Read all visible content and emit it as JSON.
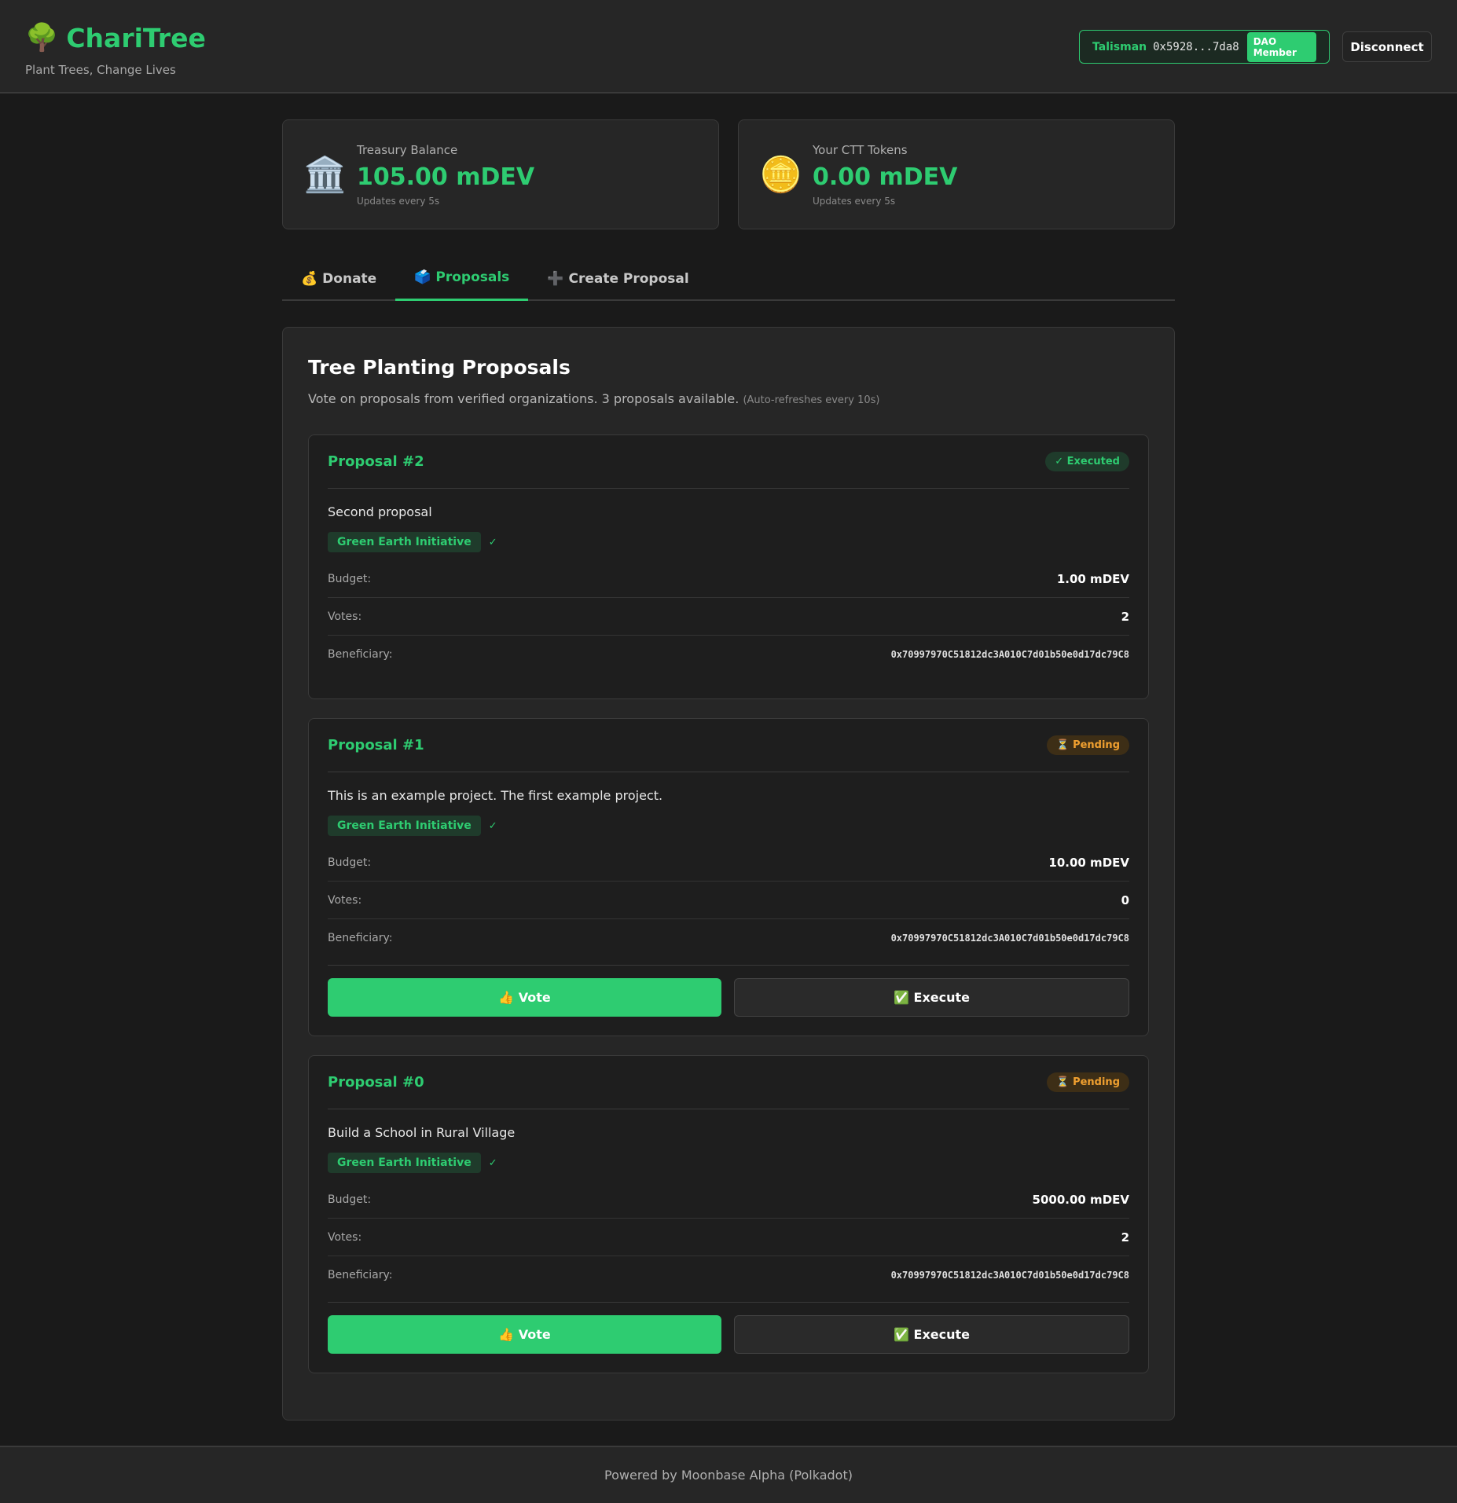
{
  "header": {
    "logo_icon": "🌳",
    "title": "ChariTree",
    "subtitle": "Plant Trees, Change Lives",
    "wallet_name": "Talisman",
    "wallet_address": "0x5928...7da8",
    "member_badge": "DAO Member",
    "disconnect_label": "Disconnect"
  },
  "stats": [
    {
      "icon": "🏛️",
      "label": "Treasury Balance",
      "value": "105.00 mDEV",
      "note": "Updates every 5s"
    },
    {
      "icon": "🪙",
      "label": "Your CTT Tokens",
      "value": "0.00 mDEV",
      "note": "Updates every 5s"
    }
  ],
  "tabs": [
    {
      "icon": "💰",
      "label": "Donate",
      "active": false
    },
    {
      "icon": "🗳️",
      "label": "Proposals",
      "active": true
    },
    {
      "icon": "➕",
      "label": "Create Proposal",
      "active": false
    }
  ],
  "panel": {
    "title": "Tree Planting Proposals",
    "description": "Vote on proposals from verified organizations. 3 proposals available.",
    "refresh_note": "(Auto-refreshes every 10s)"
  },
  "labels": {
    "budget": "Budget:",
    "votes": "Votes:",
    "beneficiary": "Beneficiary:",
    "verified": "✓"
  },
  "proposals": [
    {
      "title": "Proposal #2",
      "status": "✓ Executed",
      "description": "Second proposal",
      "organization": "Green Earth Initiative",
      "budget": "1.00 mDEV",
      "votes": "2",
      "beneficiary": "0x70997970C51812dc3A010C7d01b50e0d17dc79C8"
    },
    {
      "title": "Proposal #1",
      "status": "⏳ Pending",
      "description": "This is an example project. The first example project.",
      "organization": "Green Earth Initiative",
      "budget": "10.00 mDEV",
      "votes": "0",
      "beneficiary": "0x70997970C51812dc3A010C7d01b50e0d17dc79C8",
      "vote_label": "👍 Vote",
      "execute_label": "✅ Execute"
    },
    {
      "title": "Proposal #0",
      "status": "⏳ Pending",
      "description": "Build a School in Rural Village",
      "organization": "Green Earth Initiative",
      "budget": "5000.00 mDEV",
      "votes": "2",
      "beneficiary": "0x70997970C51812dc3A010C7d01b50e0d17dc79C8",
      "vote_label": "👍 Vote",
      "execute_label": "✅ Execute"
    }
  ],
  "footer": {
    "text": "Powered by Moonbase Alpha (Polkadot)"
  },
  "colors": {
    "accent": "#2ecc71",
    "pending": "#f0a030",
    "background": "#1a1a1a"
  }
}
